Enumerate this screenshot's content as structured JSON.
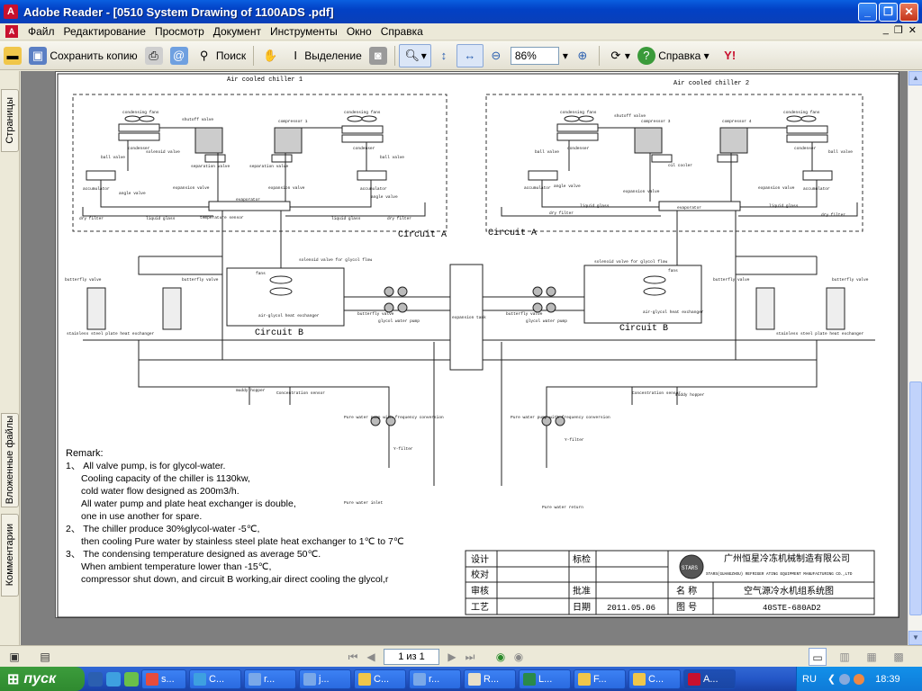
{
  "window": {
    "title": "Adobe Reader - [0510 System Drawing of 1100ADS .pdf]",
    "controls": [
      "_",
      "❐",
      "✕"
    ]
  },
  "menu": {
    "items": [
      "Файл",
      "Редактирование",
      "Просмотр",
      "Документ",
      "Инструменты",
      "Окно",
      "Справка"
    ],
    "doc_controls": [
      "_",
      "❐",
      "✕"
    ]
  },
  "toolbar": {
    "save_copy": "Сохранить копию",
    "search": "Поиск",
    "select": "Выделение",
    "zoom_value": "86%",
    "help": "Справка"
  },
  "side_tabs": {
    "pages": "Страницы",
    "attachments": "Вложенные файлы",
    "comments": "Комментарии"
  },
  "status": {
    "page_indicator": "1 из 1"
  },
  "drawing": {
    "chiller1_title": "Air cooled chiller 1",
    "chiller2_title": "Air cooled chiller 2",
    "circuit_a": "Circuit A",
    "circuit_b": "Circuit B",
    "labels": {
      "condensing_fans": "condensing fans",
      "compressor_1": "compressor 1",
      "compressor_3": "compressor 3",
      "compressor_4": "compressor 4",
      "shutoff_valve": "shutoff valve",
      "condenser": "condenser",
      "ball_valve": "ball valve",
      "solenoid_valve": "solenoid valve",
      "oil_cooler": "oil cooler",
      "separation_valve": "separation valve",
      "expansion_valve": "expansion valve",
      "accumulator": "accumulator",
      "angle_valve": "angle valve",
      "dry_filter": "dry filter",
      "liquid_glass": "liquid glass",
      "evaporator": "evaporator",
      "temp_sensor": "temperature sensor",
      "solenoid_glycol": "solenoid valve for glycol flow",
      "air_glycol": "air-glycol heat exchanger",
      "fans": "fans",
      "butterfly_valve": "butterfly valve",
      "steel_plate": "stainless steel plate heat exchanger",
      "glycol_pump": "glycol water pump",
      "expansion_tank": "expansion tank",
      "muddy_hopper": "muddy hopper",
      "concentration_sensor": "Concentration sensor",
      "pure_pump": "Pure water pump with frequency conversion",
      "y_filter": "Y-filter",
      "pure_inlet": "Pure water inlet",
      "pure_return": "Pure water return"
    },
    "remark_title": "Remark:",
    "remarks": [
      "1、 All valve pump, is for glycol-water.",
      "Cooling capacity of the chiller is 1130kw,",
      "cold water flow designed as 200m3/h.",
      "All water pump and plate heat exchanger is double,",
      "one in use another for spare.",
      "2、 The chiller produce 30%glycol-water -5℃,",
      "then cooling Pure water by  stainless steel plate heat exchanger to 1℃ to 7℃",
      "3、 The condensing temperature designed as average 50℃.",
      "When ambient temperature lower than -15℃,",
      "compressor shut down, and  circuit B working,air direct cooling the glycol,r"
    ],
    "title_block": {
      "design": "设计",
      "check": "校对",
      "review": "审核",
      "craft": "工艺",
      "standard": "标检",
      "approve": "批准",
      "date_label": "日期",
      "date_value": "2011.05.06",
      "name_label": "名  称",
      "name_value": "空气源冷水机组系统图",
      "drawing_no_label": "图  号",
      "drawing_no_value": "40STE-680AD2",
      "company_cn": "广州恒星冷冻机械制造有限公司",
      "company_en": "STARS(GUANGZHOU) REFRIGER ATING EQUIPMENT MANUFACTURING CO.,LTD",
      "logo_text": "STARS"
    }
  },
  "taskbar": {
    "start": "пуск",
    "buttons": [
      "s...",
      "C...",
      "r...",
      "j...",
      "C...",
      "r...",
      "R...",
      "L...",
      "F...",
      "C...",
      "A..."
    ],
    "lang": "RU",
    "clock": "18:39"
  }
}
